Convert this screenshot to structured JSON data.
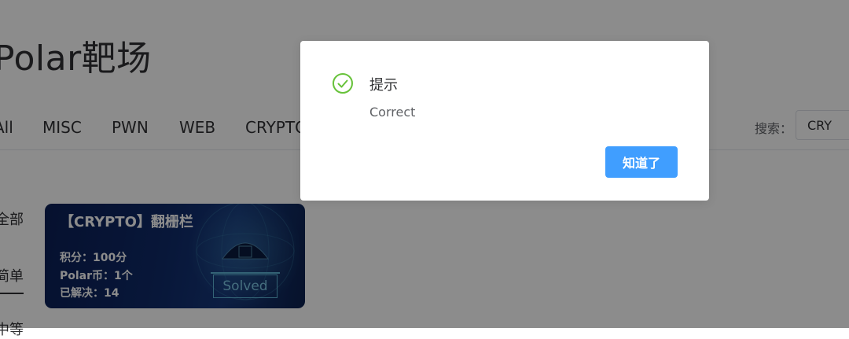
{
  "header": {
    "site_title": "Polar靶场"
  },
  "category_tabs": [
    "All",
    "MISC",
    "PWN",
    "WEB",
    "CRYPTO"
  ],
  "search": {
    "label": "搜索：",
    "value": "CRY"
  },
  "difficulty_filters": {
    "items": [
      "全部",
      "简单",
      "中等"
    ],
    "active": "简单"
  },
  "challenge_card": {
    "title": "【CRYPTO】翻栅栏",
    "points": "积分：100分",
    "coins": "Polar币：1个",
    "solved_count": "已解决：14",
    "status": "Solved"
  },
  "dialog": {
    "icon": "success-check-icon",
    "title": "提示",
    "message": "Correct",
    "confirm_label": "知道了"
  },
  "colors": {
    "primary": "#409eff",
    "success": "#67c23a",
    "card_bg": "#0f2a68",
    "overlay": "rgba(0,0,0,0.45)"
  }
}
